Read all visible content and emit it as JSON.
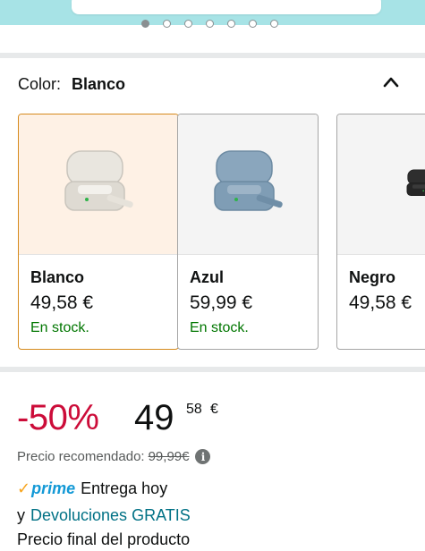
{
  "carousel": {
    "dot_count": 7,
    "active_index": 0
  },
  "color_selector": {
    "label": "Color:",
    "selected": "Blanco",
    "options": [
      {
        "name": "Blanco",
        "price": "49,58 €",
        "stock": "En stock.",
        "product_color": "#e9e6df",
        "selected": true
      },
      {
        "name": "Azul",
        "price": "59,99 €",
        "stock": "En stock.",
        "product_color": "#7f9db5",
        "selected": false
      },
      {
        "name": "Negro",
        "price": "49,58 €",
        "stock": "",
        "product_color": "#2a2a2a",
        "selected": false
      }
    ]
  },
  "price": {
    "discount": "-50%",
    "whole": "49",
    "fraction": "58",
    "currency": "€",
    "rrp_label": "Precio recomendado:",
    "rrp_value": "99,99€"
  },
  "delivery": {
    "prime_label": "prime",
    "delivery_text": "Entrega hoy",
    "returns_prefix": "y",
    "returns_link": "Devoluciones GRATIS",
    "final_price_text": "Precio final del producto"
  },
  "colors": {
    "accent_orange": "#d68a1c",
    "discount_red": "#cc0c39",
    "stock_green": "#007600",
    "link_teal": "#007185",
    "prime_blue": "#1399d6"
  }
}
